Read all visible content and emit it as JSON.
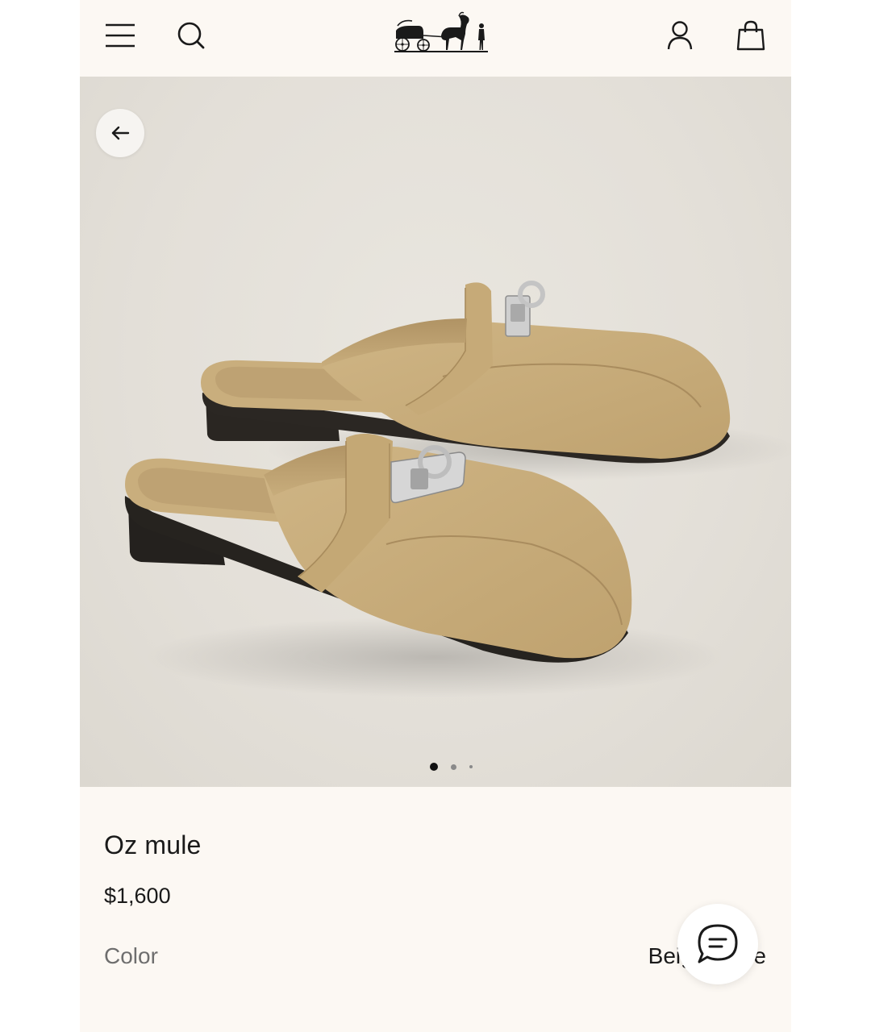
{
  "header": {
    "menu_icon": "hamburger-menu-icon",
    "search_icon": "search-icon",
    "logo": "carriage-logo",
    "account_icon": "user-account-icon",
    "bag_icon": "shopping-bag-icon"
  },
  "gallery": {
    "back_icon": "arrow-left-icon",
    "image_subject": "beige suede mules pair",
    "dots_total": 3,
    "active_index": 1
  },
  "product": {
    "name": "Oz mule",
    "price": "$1,600",
    "color_label": "Color",
    "color_value": "Beige sable"
  },
  "chat": {
    "icon": "chat-bubble-icon"
  },
  "colors": {
    "background": "#fcf8f3",
    "hero_bg": "#e3dfd8",
    "text": "#1a1a1a",
    "muted": "#6e6e6e",
    "suede": "#c7ad7c"
  }
}
